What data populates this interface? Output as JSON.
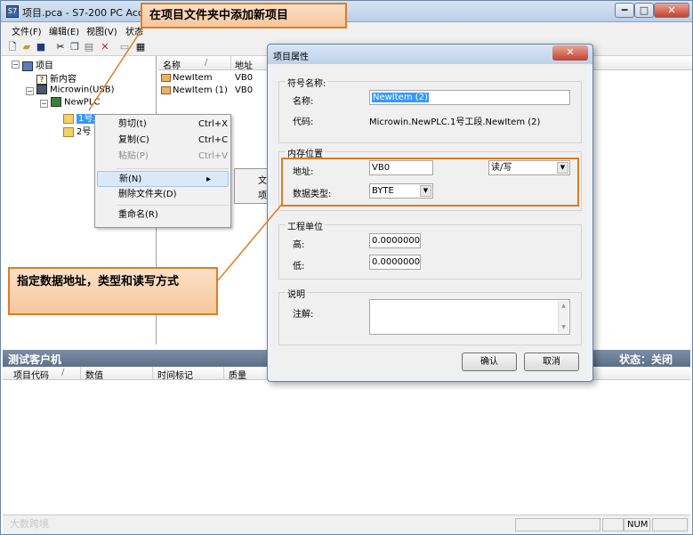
{
  "window": {
    "title": "项目.pca - S7-200 PC Access",
    "minimize_glyph": "━",
    "maximize_glyph": "□",
    "close_glyph": "✕"
  },
  "menu": {
    "items": [
      "文件(F)",
      "编辑(E)",
      "视图(V)",
      "状态"
    ]
  },
  "tree": {
    "root": "项目",
    "new_content": "新内容",
    "microwin": "Microwin(USB)",
    "plc": "NewPLC",
    "folder1": "1号工段",
    "folder2": "2号"
  },
  "list": {
    "columns": [
      "名称",
      "地址"
    ],
    "rows": [
      {
        "name": "NewItem",
        "address": "VB0"
      },
      {
        "name": "NewItem (1)",
        "address": "VB0"
      }
    ]
  },
  "context_menu": {
    "cut": "剪切(t)",
    "cut_shortcut": "Ctrl+X",
    "copy": "复制(C)",
    "copy_shortcut": "Ctrl+C",
    "paste": "粘贴(P)",
    "paste_shortcut": "Ctrl+V",
    "new": "新(N)",
    "delete_folder": "删除文件夹(D)",
    "rename": "重命名(R)",
    "submenu_1": "文",
    "submenu_2": "项"
  },
  "dialog": {
    "title": "项目属性",
    "close_glyph": "✕",
    "symbol_group": "符号名称:",
    "name_label": "名称:",
    "name_value": "NewItem (2)",
    "code_label": "代码:",
    "code_value": "Microwin.NewPLC.1号工段.NewItem (2)",
    "memory_group": "内存位置",
    "address_label": "地址:",
    "address_value": "VB0",
    "access_value": "读/写",
    "datatype_label": "数据类型:",
    "datatype_value": "BYTE",
    "unit_group": "工程单位",
    "high_label": "高:",
    "high_value": "0.0000000",
    "low_label": "低:",
    "low_value": "0.0000000",
    "desc_group": "说明",
    "comment_label": "注解:",
    "ok": "确认",
    "cancel": "取消"
  },
  "debug": {
    "title": "测试客户机",
    "status": "状态：关闭",
    "columns": [
      "项目代码",
      "数值",
      "时间标记",
      "质量"
    ]
  },
  "status_bar": {
    "num": "NUM"
  },
  "watermark": "大数跨境",
  "callouts": {
    "top": "在项目文件夹中添加新项目",
    "left": "指定数据地址，类型和读写方式"
  },
  "colors": {
    "callout_border": "#e07c23",
    "callout_fill": "#f7c79d",
    "selection": "#3399ff"
  }
}
